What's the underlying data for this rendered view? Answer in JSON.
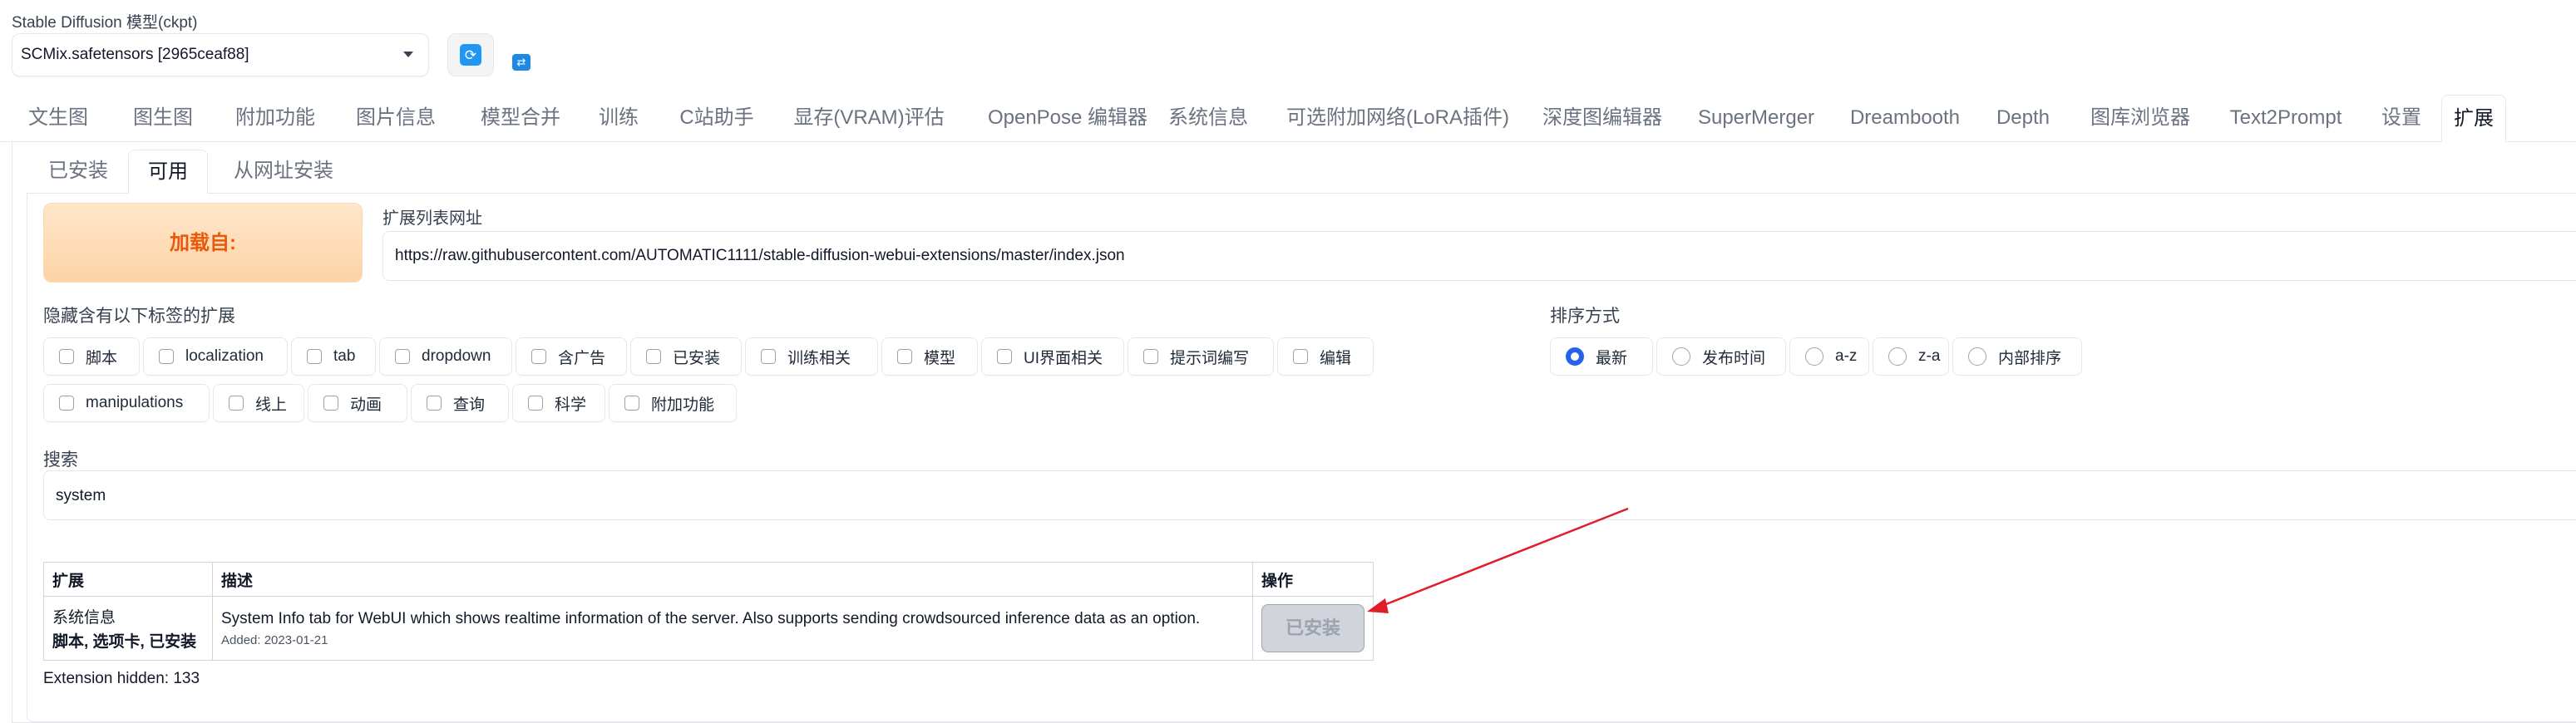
{
  "model": {
    "label": "Stable Diffusion 模型(ckpt)",
    "selected": "SCMix.safetensors [2965ceaf88]",
    "refresh_icon": "refresh-icon",
    "swap_icon": "swap-icon"
  },
  "main_tabs": [
    {
      "label": "文生图"
    },
    {
      "label": "图生图"
    },
    {
      "label": "附加功能"
    },
    {
      "label": "图片信息"
    },
    {
      "label": "模型合并"
    },
    {
      "label": "训练"
    },
    {
      "label": "C站助手"
    },
    {
      "label": "显存(VRAM)评估"
    },
    {
      "label": "OpenPose 编辑器"
    },
    {
      "label": "系统信息"
    },
    {
      "label": "可选附加网络(LoRA插件)"
    },
    {
      "label": "深度图编辑器"
    },
    {
      "label": "SuperMerger"
    },
    {
      "label": "Dreambooth"
    },
    {
      "label": "Depth"
    },
    {
      "label": "图库浏览器"
    },
    {
      "label": "Text2Prompt"
    },
    {
      "label": "设置"
    },
    {
      "label": "扩展",
      "active": true
    }
  ],
  "sub_tabs": [
    {
      "label": "已安装"
    },
    {
      "label": "可用",
      "active": true
    },
    {
      "label": "从网址安装"
    }
  ],
  "load": {
    "button_label": "加载自:",
    "url_label": "扩展列表网址",
    "url_value": "https://raw.githubusercontent.com/AUTOMATIC1111/stable-diffusion-webui-extensions/master/index.json"
  },
  "hide_tags": {
    "label": "隐藏含有以下标签的扩展",
    "row1": [
      "脚本",
      "localization",
      "tab",
      "dropdown",
      "含广告",
      "已安装",
      "训练相关",
      "模型",
      "UI界面相关",
      "提示词编写",
      "编辑"
    ],
    "row2": [
      "manipulations",
      "线上",
      "动画",
      "查询",
      "科学",
      "附加功能"
    ]
  },
  "sort": {
    "label": "排序方式",
    "options": [
      "最新",
      "发布时间",
      "a-z",
      "z-a",
      "内部排序"
    ],
    "selected": "最新"
  },
  "search": {
    "label": "搜索",
    "value": "system"
  },
  "table": {
    "headers": [
      "扩展",
      "描述",
      "操作"
    ],
    "rows": [
      {
        "name": "系统信息",
        "tags": "脚本, 选项卡, 已安装",
        "description": "System Info tab for WebUI which shows realtime information of the server. Also supports sending crowdsourced inference data as an option.",
        "added": "Added: 2023-01-21",
        "action": "已安装"
      }
    ]
  },
  "hidden_count_text": "Extension hidden: 133",
  "annotation": {
    "arrow_color": "#e11d2a"
  },
  "colors": {
    "accent": "#2563eb",
    "load_button_text": "#ea580c"
  }
}
